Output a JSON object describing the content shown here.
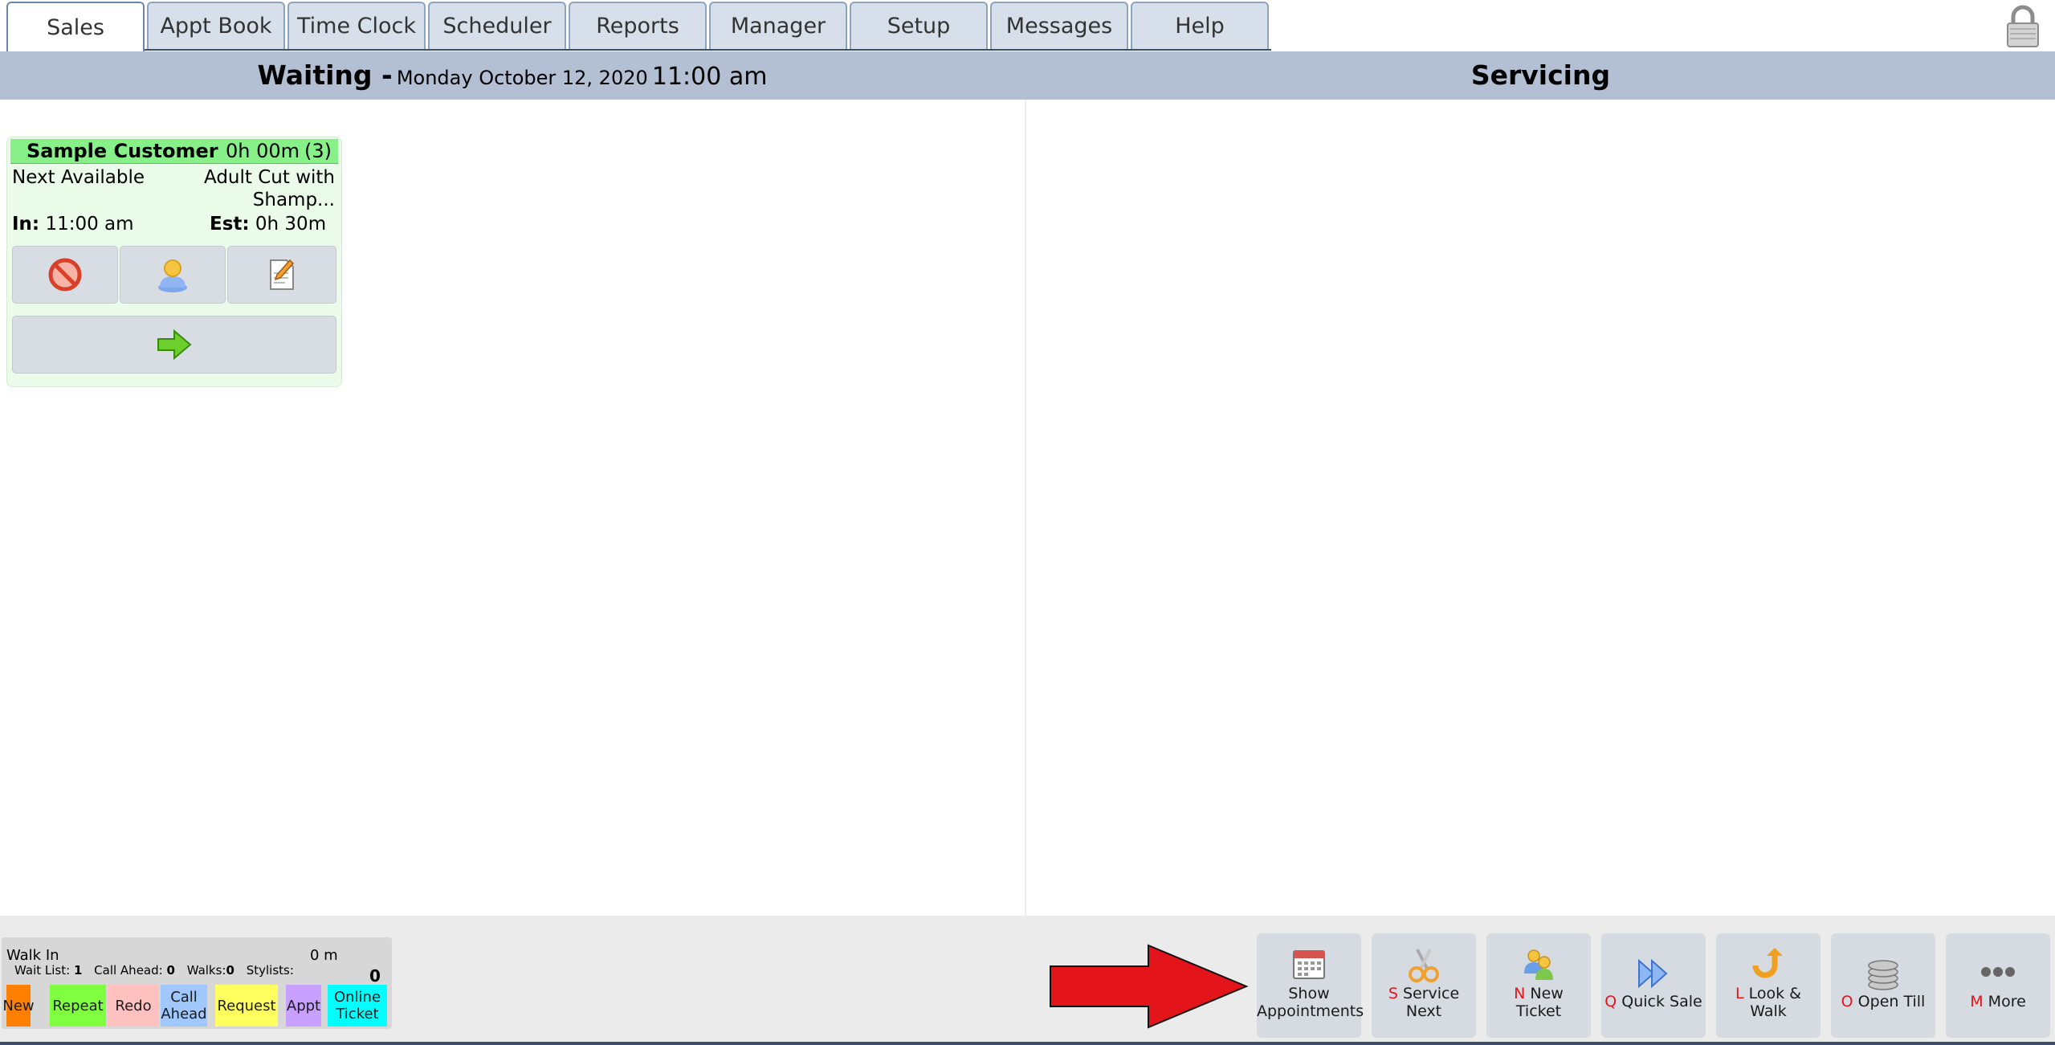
{
  "tabs": [
    "Sales",
    "Appt Book",
    "Time Clock",
    "Scheduler",
    "Reports",
    "Manager",
    "Setup",
    "Messages",
    "Help"
  ],
  "active_tab": "Sales",
  "header": {
    "waiting_label": "Waiting -",
    "date": "Monday October 12, 2020",
    "time": "11:00 am",
    "servicing_label": "Servicing"
  },
  "ticket": {
    "customer": "Sample Customer",
    "elapsed": "0h 00m",
    "count": "(3)",
    "stylist": "Next Available",
    "service_line1": "Adult Cut with",
    "service_line2": "Shamp...",
    "in_label": "In:",
    "in_time": "11:00 am",
    "est_label": "Est:",
    "est_time": "0h 30m",
    "header_color": "#88f088",
    "card_color": "#eafbea"
  },
  "walkin": {
    "label": "Walk In",
    "time": "0 m",
    "wait_list_label": "Wait List:",
    "wait_list": "1",
    "call_ahead_label": "Call Ahead:",
    "call_ahead": "0",
    "walks_label": "Walks:",
    "walks": "0",
    "stylists_label": "Stylists:",
    "total": "0"
  },
  "legend": [
    {
      "line1": "New",
      "line2": "",
      "color": "#ff8000"
    },
    {
      "line1": "Repeat",
      "line2": "",
      "color": "#80ff40"
    },
    {
      "line1": "Redo",
      "line2": "",
      "color": "#ffc0c0"
    },
    {
      "line1": "Call",
      "line2": "Ahead",
      "color": "#a0c8ff"
    },
    {
      "line1": "Request",
      "line2": "",
      "color": "#ffff60"
    },
    {
      "line1": "Appt",
      "line2": "",
      "color": "#c8a0ff"
    },
    {
      "line1": "Online",
      "line2": "Ticket",
      "color": "#00ffff"
    }
  ],
  "actions": [
    {
      "key": "",
      "line1": "Show",
      "line2": "Appointments",
      "icon": "calendar-icon"
    },
    {
      "key": "S",
      "line1": "Service",
      "line2": "Next",
      "icon": "scissors-icon"
    },
    {
      "key": "N",
      "line1": "New",
      "line2": "Ticket",
      "icon": "people-icon"
    },
    {
      "key": "Q",
      "line1": "Quick Sale",
      "line2": "",
      "icon": "fast-forward-icon"
    },
    {
      "key": "L",
      "line1": "Look &",
      "line2": "Walk",
      "icon": "u-turn-icon"
    },
    {
      "key": "O",
      "line1": "Open Till",
      "line2": "",
      "icon": "coin-stack-icon"
    },
    {
      "key": "M",
      "line1": "More",
      "line2": "",
      "icon": "more-dots-icon"
    }
  ],
  "colors": {
    "header_bg": "#b3bfd2",
    "tab_bg": "#d7e0ea",
    "annotation_arrow": "#e3151b",
    "hotkey": "#e0161b"
  }
}
